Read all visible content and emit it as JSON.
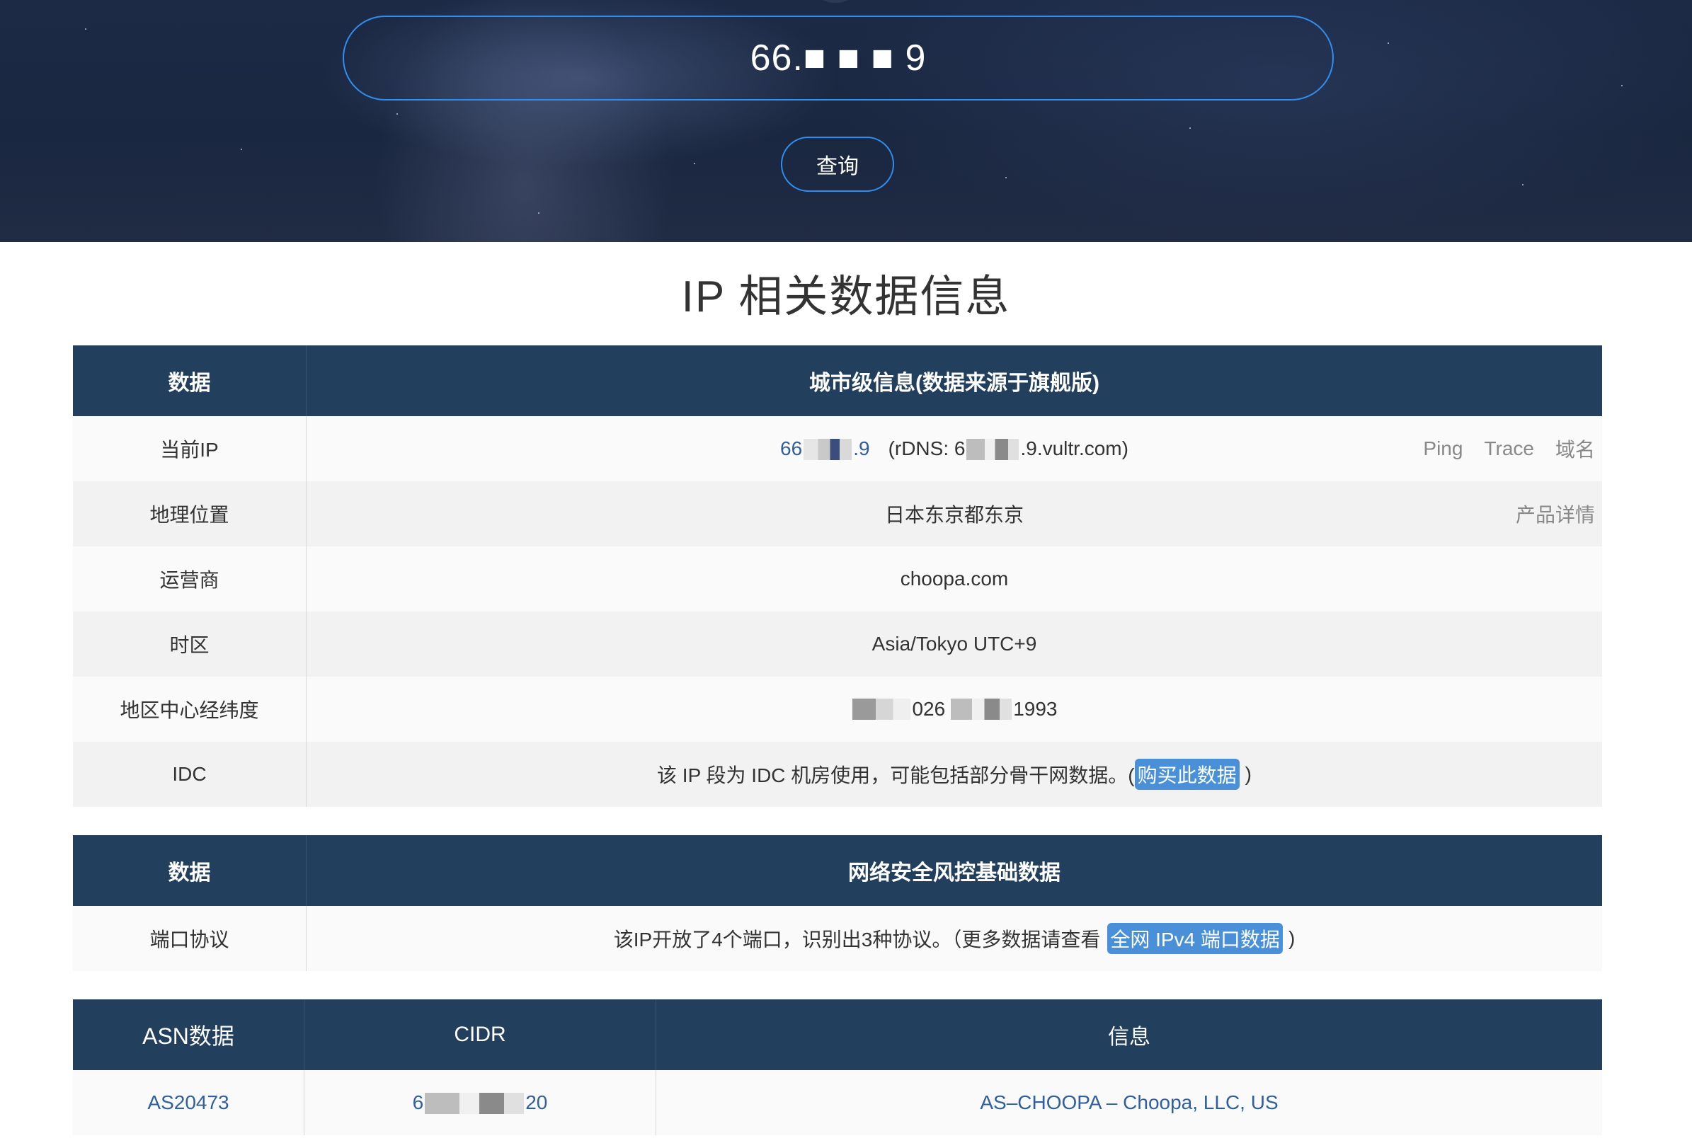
{
  "search": {
    "value": "66.■ ■ ■ 9",
    "button_label": "查询"
  },
  "section_title": "IP 相关数据信息",
  "city_table": {
    "header_col1": "数据",
    "header_col2": "城市级信息(数据来源于旗舰版)",
    "current_ip": {
      "label": "当前IP",
      "ip_prefix": "66",
      "ip_suffix": ".9",
      "rdns_prefix": "(rDNS: 6",
      "rdns_suffix": ".9.vultr.com)",
      "links": [
        "Ping",
        "Trace",
        "域名"
      ]
    },
    "location": {
      "label": "地理位置",
      "value": "日本东京都东京",
      "link": "产品详情"
    },
    "isp": {
      "label": "运营商",
      "value": "choopa.com"
    },
    "timezone": {
      "label": "时区",
      "value": "Asia/Tokyo UTC+9"
    },
    "coords": {
      "label": "地区中心经纬度",
      "value_a": "026",
      "value_b": "1993"
    },
    "idc": {
      "label": "IDC",
      "text_before": "该 IP 段为 IDC 机房使用，可能包括部分骨干网数据。(",
      "link": "购买此数据",
      "text_after": ")"
    }
  },
  "security_table": {
    "header_col1": "数据",
    "header_col2": "网络安全风控基础数据",
    "ports": {
      "label": "端口协议",
      "text_before": "该IP开放了4个端口，识别出3种协议。（更多数据请查看",
      "link": "全网 IPv4 端口数据",
      "text_after": ")"
    }
  },
  "asn_table": {
    "headers": [
      "ASN数据",
      "CIDR",
      "信息"
    ],
    "rows": [
      {
        "asn": "AS20473",
        "cidr_prefix": "6",
        "cidr_suffix": "20",
        "info": "AS–CHOOPA – Choopa, LLC, US"
      }
    ]
  },
  "colors": {
    "header_bg": "#233f5e",
    "accent_blue": "#2f8ff0",
    "link_pill": "#4a90d9"
  }
}
